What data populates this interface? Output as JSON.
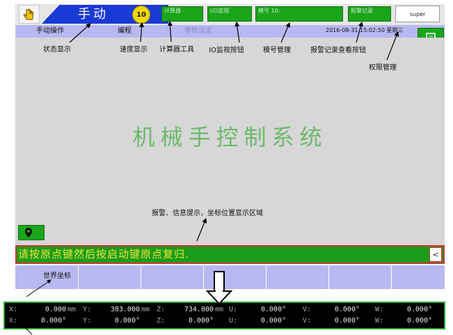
{
  "header": {
    "mode_label": "手动",
    "speed_value": "10",
    "calculator_label": "计算器",
    "io_label": "I/O监视",
    "mold_label": "模号 10:",
    "alarm_record_label": "报警记录",
    "user_label": "super"
  },
  "tabs": [
    {
      "label": "手动操作"
    },
    {
      "label": "编程"
    },
    {
      "label": "参数设定"
    }
  ],
  "datetime": "2016-08-31  15:02:50  星期三",
  "main": {
    "system_title": "机械手控制系统"
  },
  "message": {
    "text": "请按原点键然后按启动键原点复归."
  },
  "coordinate_tab": "世界坐标",
  "coordinates": {
    "row1": [
      {
        "axis": "X:",
        "value": "0.000",
        "unit": "mm"
      },
      {
        "axis": "Y:",
        "value": "383.000",
        "unit": "mm"
      },
      {
        "axis": "Z:",
        "value": "734.000",
        "unit": "mm"
      },
      {
        "axis": "U:",
        "value": "0.000°",
        "unit": ""
      },
      {
        "axis": "V:",
        "value": "0.000°",
        "unit": ""
      },
      {
        "axis": "W:",
        "value": "0.000°",
        "unit": ""
      }
    ],
    "row2": [
      {
        "axis": "X:",
        "value": "0.000°",
        "unit": ""
      },
      {
        "axis": "Y:",
        "value": "0.000°",
        "unit": ""
      },
      {
        "axis": "Z:",
        "value": "0.000°",
        "unit": ""
      },
      {
        "axis": "U:",
        "value": "0.000°",
        "unit": ""
      },
      {
        "axis": "V:",
        "value": "0.000°",
        "unit": ""
      },
      {
        "axis": "W:",
        "value": "0.000°",
        "unit": ""
      }
    ]
  },
  "annotations": {
    "status_display": "状态显示",
    "speed_display": "速度显示",
    "calculator_tool": "计算器工具",
    "io_monitor_button": "IO监视按钮",
    "mold_management": "模号管理",
    "alarm_record_button": "报警记录查看按钮",
    "permission_management": "权限管理",
    "info_area": "报警、信息提示，坐标位置显示区域"
  },
  "colors": {
    "mode_banner": "#1a3ad6",
    "button_green": "#1aa51a",
    "tab_bar": "#b8b8f2",
    "message_text": "#f0e43a",
    "message_border": "#d83232"
  }
}
